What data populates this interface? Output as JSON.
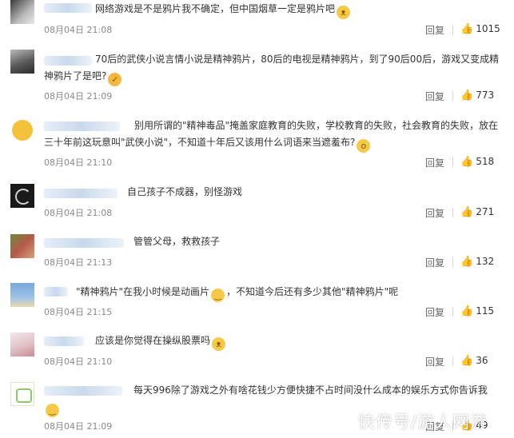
{
  "comments": [
    {
      "text": "网络游戏是不是鸦片我不确定，但中国烟草一定是鸦片吧",
      "emoji": "😺",
      "date": "08月04日 21:08",
      "reply": "回复",
      "likes": "1015"
    },
    {
      "text": "70后的武侠小说言情小说是精神鸦片，80后的电视是精神鸦片，到了90后00后，游戏又变成精神鸦片了是吧?",
      "emoji": "👍",
      "date": "08月04日 21:09",
      "reply": "回复",
      "likes": "773"
    },
    {
      "text": "别用所谓的\"精神毒品\"掩盖家庭教育的失败，学校教育的失败，社会教育的失败，放在三十年前这玩意叫\"武侠小说\"，不知道十年后又该用什么词语来当遮羞布?",
      "emoji": "😲",
      "date": "08月04日 21:10",
      "reply": "回复",
      "likes": "518"
    },
    {
      "text": "自己孩子不成器，别怪游戏",
      "emoji": "",
      "date": "08月04日 21:08",
      "reply": "回复",
      "likes": "271"
    },
    {
      "text": "管管父母，救救孩子",
      "emoji": "",
      "date": "08月04日 21:13",
      "reply": "回复",
      "likes": "132"
    },
    {
      "text": "\"精神鸦片\"在我小时候是动画片",
      "text2": "，不知道今后还有多少其他\"精神鸦片\"呢",
      "emoji": "😊",
      "date": "08月04日 21:15",
      "reply": "回复",
      "likes": "115"
    },
    {
      "text": "应该是你觉得在操纵股票吗",
      "emoji": "😺",
      "date": "08月04日 21:10",
      "reply": "回复",
      "likes": "36"
    },
    {
      "text": "每天996除了游戏之外有啥花钱少方便快捷不占时间没什么成本的娱乐方式你告诉我",
      "emoji": "😊",
      "date": "08月04日 21:09",
      "reply": "回复",
      "likes": "49"
    }
  ],
  "watermark": "快传号/游人网游"
}
